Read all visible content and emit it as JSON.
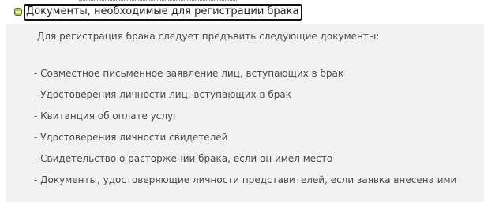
{
  "faq": {
    "title": "Документы, необходимые для регистрации брака",
    "intro": "Для регистрация брака следует предъвить следующие документы:",
    "items": [
      "- Совместное письменное заявление лиц, вступающих в брак",
      "- Удостоверения личности лиц, вступающих в брак",
      "- Квитанция об оплате услуг",
      "- Удостоверения личности свидетелей",
      "- Свидетельство о расторжении брака, если он имел место",
      "- Документы, удостоверяющие личности представителей, если заявка внесена ими"
    ],
    "toggle_icon": "collapse-icon",
    "colors": {
      "toggle": "#b5c95a",
      "panel_background": "#f2f2f2"
    }
  }
}
